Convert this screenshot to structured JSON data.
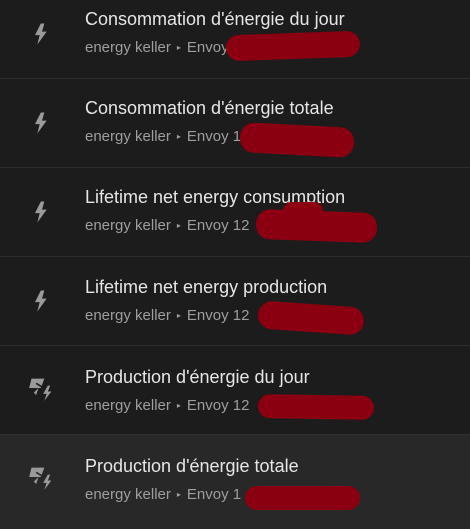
{
  "colors": {
    "background": "#1c1c1c",
    "selected_background": "#282828",
    "title_text": "#e6e6e6",
    "subtitle_text": "#9e9e9e",
    "redaction": "#8a0010"
  },
  "items": [
    {
      "title": "Consommation d'énergie du jour",
      "device": "energy keller",
      "separator": "▸",
      "entity": "Envoy",
      "icon": "lightning-bolt-icon"
    },
    {
      "title": "Consommation d'énergie totale",
      "device": "energy keller",
      "separator": "▸",
      "entity": "Envoy 1",
      "icon": "lightning-bolt-icon"
    },
    {
      "title": "Lifetime net energy consumption",
      "device": "energy keller",
      "separator": "▸",
      "entity": "Envoy 12",
      "icon": "lightning-bolt-icon"
    },
    {
      "title": "Lifetime net energy production",
      "device": "energy keller",
      "separator": "▸",
      "entity": "Envoy 12",
      "icon": "lightning-bolt-icon"
    },
    {
      "title": "Production d'énergie du jour",
      "device": "energy keller",
      "separator": "▸",
      "entity": "Envoy 12",
      "icon": "solar-power-icon"
    },
    {
      "title": "Production d'énergie totale",
      "device": "energy keller",
      "separator": "▸",
      "entity": "Envoy 1",
      "icon": "solar-power-icon"
    }
  ]
}
